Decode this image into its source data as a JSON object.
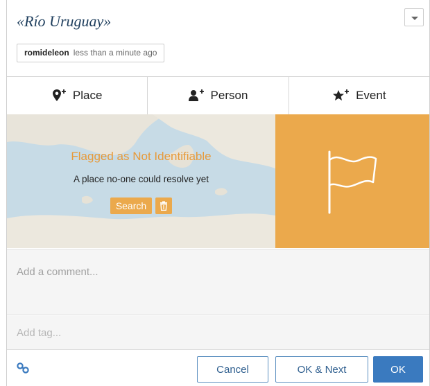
{
  "header": {
    "title": "«Río Uruguay»",
    "user": "romideleon",
    "time": "less than a minute ago"
  },
  "tabs": [
    {
      "label": "Place",
      "icon": "map-marker-plus-icon"
    },
    {
      "label": "Person",
      "icon": "user-plus-icon"
    },
    {
      "label": "Event",
      "icon": "star-plus-icon"
    }
  ],
  "status": {
    "title": "Flagged as Not Identifiable",
    "subtitle": "A place no-one could resolve yet",
    "search_label": "Search"
  },
  "comment": {
    "placeholder": "Add a comment..."
  },
  "tag": {
    "placeholder": "Add tag..."
  },
  "footer": {
    "cancel_label": "Cancel",
    "ok_next_label": "OK & Next",
    "ok_label": "OK"
  },
  "colors": {
    "accent": "#eba94c",
    "primary": "#3a7abf",
    "title": "#1d3d5c"
  }
}
